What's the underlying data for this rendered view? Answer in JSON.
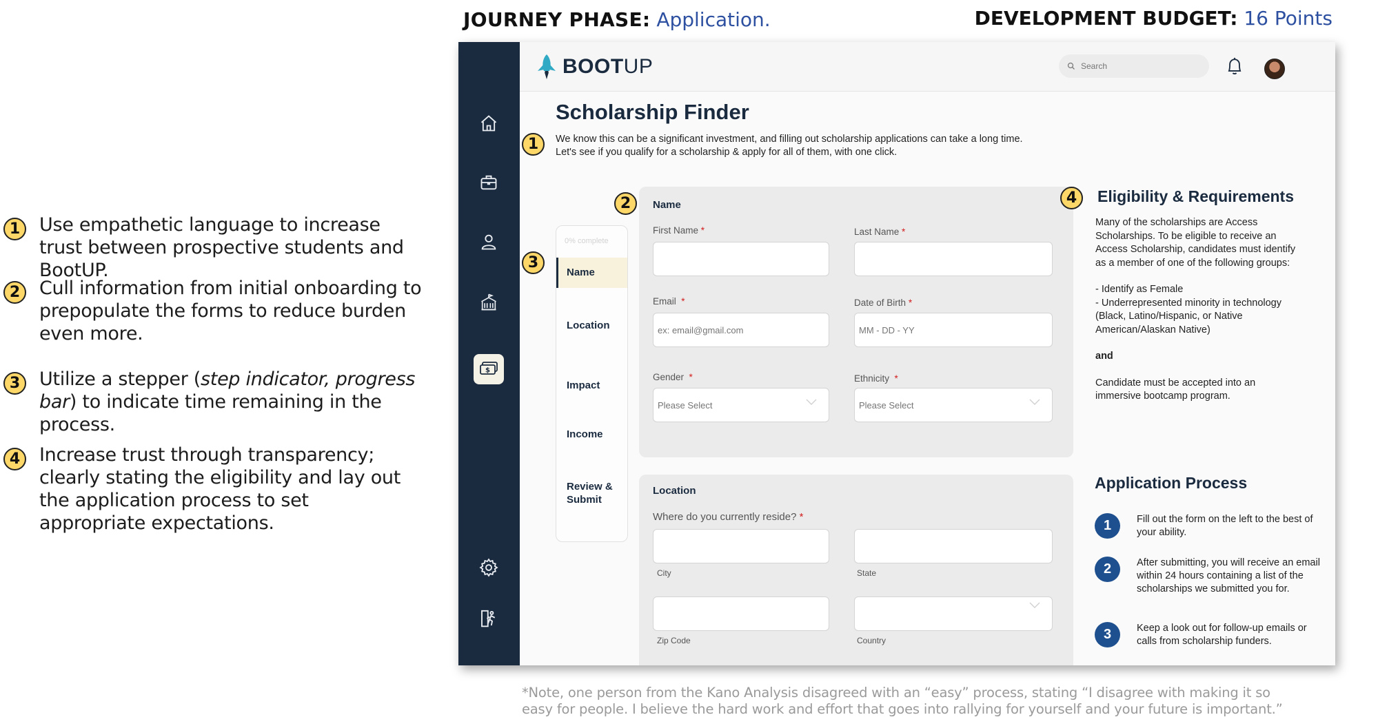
{
  "header": {
    "phase_label": "JOURNEY PHASE:",
    "phase_value": "Application.",
    "budget_label": "DEVELOPMENT BUDGET:",
    "budget_value": "16 Points"
  },
  "notes": [
    {
      "num": "1",
      "text": "Use empathetic language to increase trust between prospective students and BootUP."
    },
    {
      "num": "2",
      "text": "Cull information from initial onboarding to prepopulate the forms to reduce burden even more."
    },
    {
      "num": "3",
      "text_before": "Utilize a stepper (",
      "text_italic": "step indicator, progress bar",
      "text_after": ") to indicate time remaining in the process."
    },
    {
      "num": "4",
      "text": "Increase trust through transparency; clearly stating the eligibility and lay out the application process to set appropriate expectations."
    }
  ],
  "app": {
    "logo_bold": "BOOT",
    "logo_light": "UP",
    "search_placeholder": "Search",
    "page_title": "Scholarship Finder",
    "intro_line1": "We know this can be a significant investment, and filling out scholarship applications can take a long time.",
    "intro_line2": "Let's see if you qualify for a scholarship & apply for all of them, with one click.",
    "badges": {
      "intro": "1",
      "name_panel": "2",
      "stepper": "3",
      "eligibility": "4"
    }
  },
  "stepper": {
    "progress_text": "0% complete",
    "steps": [
      "Name",
      "Location",
      "Impact",
      "Income",
      "Review & Submit"
    ]
  },
  "name_panel": {
    "title": "Name",
    "first_name_label": "First Name",
    "last_name_label": "Last Name",
    "email_label": "Email",
    "email_placeholder": "ex: email@gmail.com",
    "dob_label": "Date of Birth",
    "dob_placeholder": "MM - DD - YY",
    "gender_label": "Gender",
    "gender_placeholder": "Please Select",
    "ethnicity_label": "Ethnicity",
    "ethnicity_placeholder": "Please Select",
    "required_mark": "*"
  },
  "location_panel": {
    "title": "Location",
    "question": "Where do you currently reside?",
    "city_label": "City",
    "state_label": "State",
    "zip_label": "Zip Code",
    "country_label": "Country"
  },
  "eligibility": {
    "title": "Eligibility & Requirements",
    "intro": "Many of the scholarships are Access Scholarships. To be eligible to receive an Access Scholarship, candidates must identify as a member of one of the following groups:",
    "item1": "- Identify as Female",
    "item2": "- Underrepresented minority in technology (Black, Latino/Hispanic, or Native American/Alaskan Native)",
    "and_word": "and",
    "closing": "Candidate must be accepted into an immersive bootcamp program."
  },
  "application_process": {
    "title": "Application Process",
    "steps": [
      {
        "num": "1",
        "text": "Fill out the form on the left to the best of your ability."
      },
      {
        "num": "2",
        "text": "After submitting, you will receive an email within 24 hours containing a list of the scholarships we submitted you for."
      },
      {
        "num": "3",
        "text": "Keep a look out for follow-up emails or calls from scholarship funders."
      }
    ]
  },
  "footnote": {
    "line1": "*Note, one person from the Kano Analysis disagreed with an “easy” process, stating “I disagree with making it so",
    "line2": "easy for people. I believe the hard work and effort that goes into rallying for yourself and your future is important.”"
  },
  "colors": {
    "navy": "#1b2b3f",
    "accent_blue": "#2e50a0",
    "badge_yellow": "#fdd868",
    "required_red": "#d21d1d",
    "step_blue": "#1e4f8e"
  },
  "icons": [
    "home-icon",
    "briefcase-icon",
    "user-icon",
    "school-icon",
    "money-icon",
    "settings-icon",
    "exit-icon",
    "search-icon",
    "bell-icon",
    "rocket-logo-icon",
    "chevron-down-icon"
  ]
}
